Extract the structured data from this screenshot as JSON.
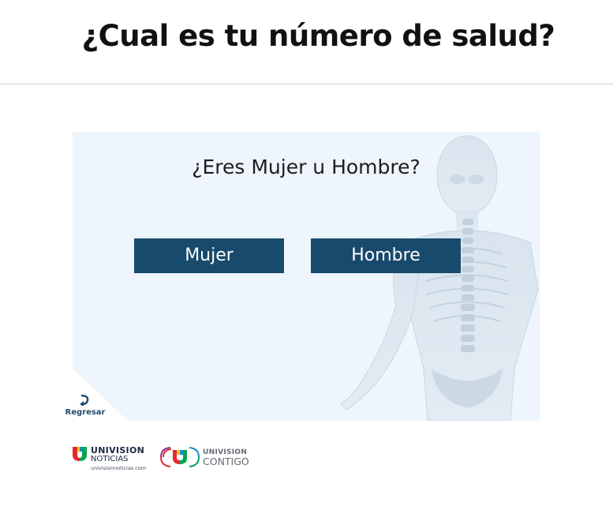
{
  "page": {
    "title": "¿Cual es tu número de salud?"
  },
  "quiz": {
    "question": "¿Eres Mujer u Hombre?",
    "options": [
      "Mujer",
      "Hombre"
    ],
    "button_color": "#174a6c",
    "background_illustration": "human-anatomy-skeleton"
  },
  "navigation": {
    "back_label": "Regresar",
    "back_icon": "curved-arrow-icon"
  },
  "footer": {
    "logos": [
      {
        "name": "univision-noticias-logo",
        "line1": "UNIVISION",
        "line2": "NOTICIAS",
        "line3": "univisionnoticias.com"
      },
      {
        "name": "univision-contigo-logo",
        "line1": "UNIVISION",
        "line2": "CONTIGO"
      }
    ]
  },
  "colors": {
    "accent": "#174a6c",
    "card_background": "#eef5fc",
    "logo_mark": [
      "#e6282d",
      "#ffc629",
      "#00a651",
      "#1c8ad1",
      "#8e2c8f"
    ]
  }
}
